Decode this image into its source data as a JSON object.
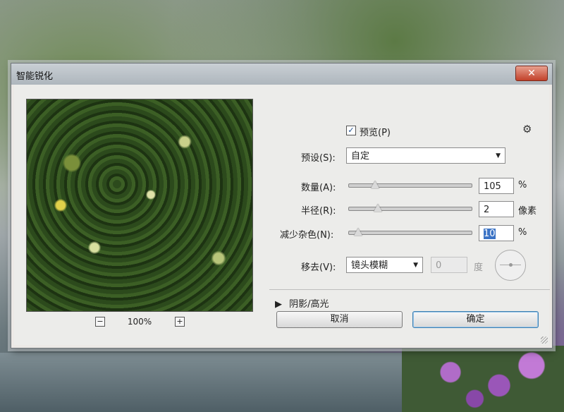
{
  "dialog": {
    "title": "智能锐化",
    "close_label": "✕"
  },
  "preview": {
    "zoom_out": "−",
    "zoom_level": "100%",
    "zoom_in": "+"
  },
  "options": {
    "preview_checkbox_label": "预览(P)",
    "preview_checked": true,
    "preset_label": "预设(S):",
    "preset_value": "自定",
    "amount_label": "数量(A):",
    "amount_value": "105",
    "amount_unit": "%",
    "amount_fraction": 0.22,
    "radius_label": "半径(R):",
    "radius_value": "2",
    "radius_unit": "像素",
    "radius_fraction": 0.24,
    "noise_label": "减少杂色(N):",
    "noise_value": "10",
    "noise_unit": "%",
    "noise_fraction": 0.08,
    "remove_label": "移去(V):",
    "remove_value": "镜头模糊",
    "angle_value": "0",
    "angle_unit": "度",
    "shadows_label": "阴影/高光"
  },
  "buttons": {
    "cancel": "取消",
    "ok": "确定"
  }
}
